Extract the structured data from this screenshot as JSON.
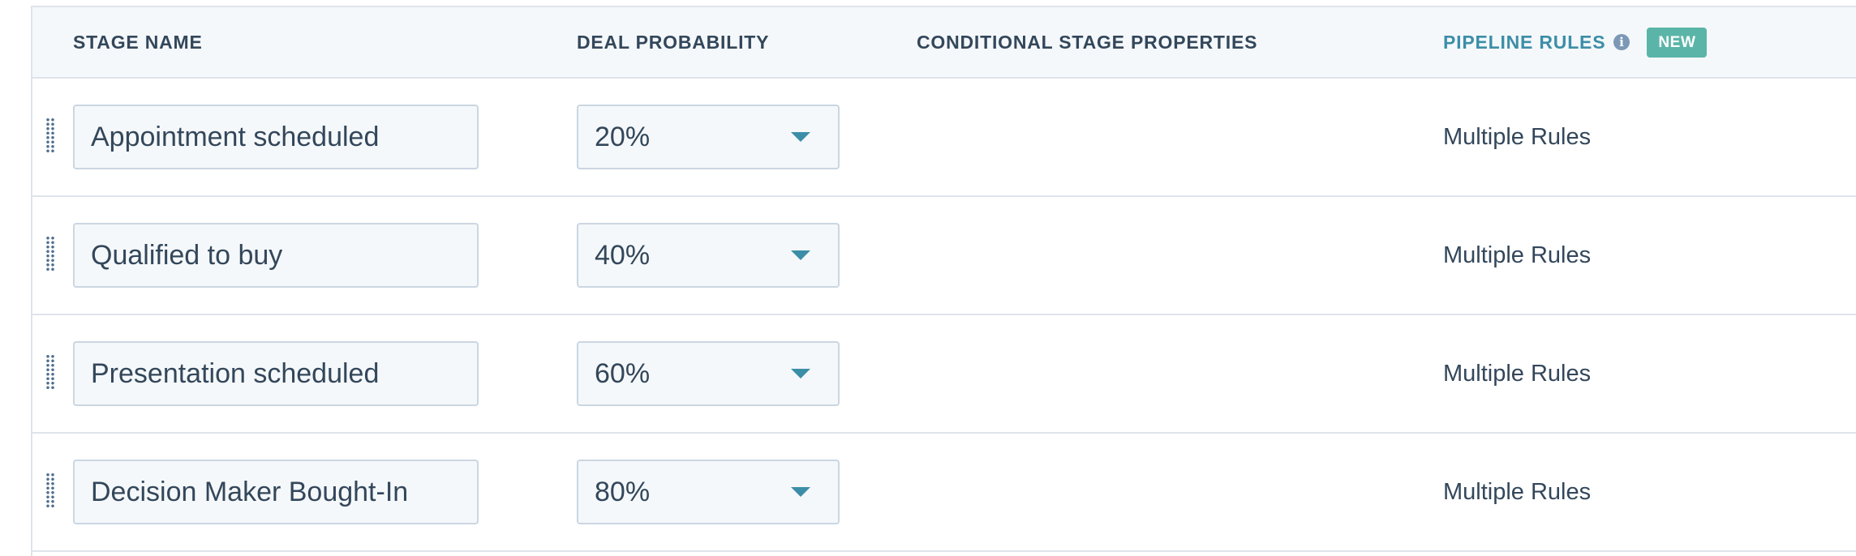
{
  "header": {
    "stage_name": "STAGE NAME",
    "deal_probability": "DEAL PROBABILITY",
    "conditional_stage_properties": "CONDITIONAL STAGE PROPERTIES",
    "pipeline_rules": "PIPELINE RULES",
    "info_icon": "i",
    "new_badge": "NEW"
  },
  "colors": {
    "accent": "#3c8ea8",
    "badge": "#5ab5a8",
    "text": "#33475b",
    "border": "#dfe3eb",
    "header_bg": "#f5f8fa"
  },
  "rows": [
    {
      "stage_name": "Appointment scheduled",
      "probability": "20%",
      "rules": "Multiple Rules"
    },
    {
      "stage_name": "Qualified to buy",
      "probability": "40%",
      "rules": "Multiple Rules"
    },
    {
      "stage_name": "Presentation scheduled",
      "probability": "60%",
      "rules": "Multiple Rules"
    },
    {
      "stage_name": "Decision Maker Bought-In",
      "probability": "80%",
      "rules": "Multiple Rules"
    }
  ]
}
